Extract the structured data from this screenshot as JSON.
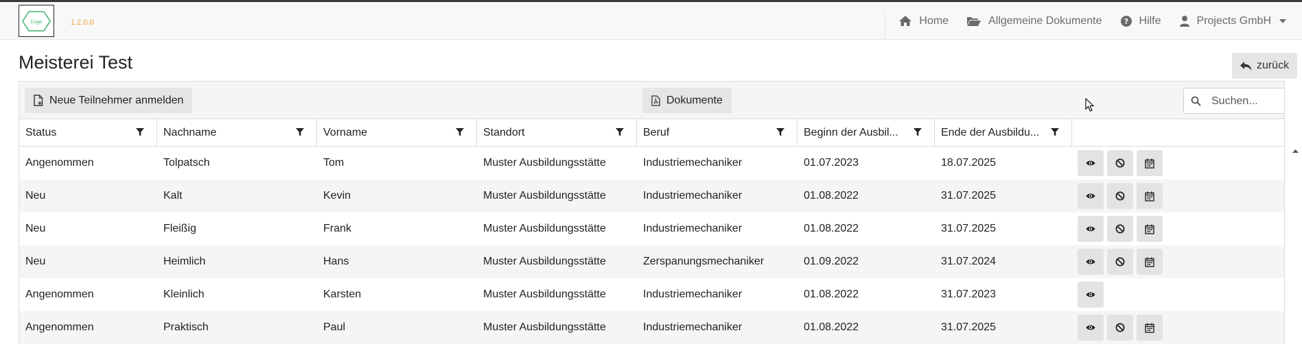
{
  "app": {
    "logo_text": "Logo",
    "version": "1.2.0.0"
  },
  "nav": {
    "items": [
      {
        "label": "Home",
        "icon": "home-icon"
      },
      {
        "label": "Allgemeine Dokumente",
        "icon": "folder-open-icon"
      },
      {
        "label": "Hilfe",
        "icon": "question-circle-icon"
      },
      {
        "label": "Projects GmbH",
        "icon": "user-icon"
      }
    ]
  },
  "page": {
    "title": "Meisterei Test",
    "back_label": "zurück"
  },
  "toolbar": {
    "new_label": "Neue Teilnehmer anmelden",
    "docs_label": "Dokumente",
    "search_placeholder": "Suchen..."
  },
  "table": {
    "columns": [
      "Status",
      "Nachname",
      "Vorname",
      "Standort",
      "Beruf",
      "Beginn der Ausbil...",
      "Ende der Ausbildu...",
      ""
    ],
    "rows": [
      {
        "status": "Angenommen",
        "nachname": "Tolpatsch",
        "vorname": "Tom",
        "standort": "Muster Ausbildungsstätte",
        "beruf": "Industriemechaniker",
        "beginn": "01.07.2023",
        "ende": "18.07.2025",
        "actions": [
          "view",
          "cancel",
          "calendar"
        ]
      },
      {
        "status": "Neu",
        "nachname": "Kalt",
        "vorname": "Kevin",
        "standort": "Muster Ausbildungsstätte",
        "beruf": "Industriemechaniker",
        "beginn": "01.08.2022",
        "ende": "31.07.2025",
        "actions": [
          "view",
          "cancel",
          "calendar"
        ]
      },
      {
        "status": "Neu",
        "nachname": "Fleißig",
        "vorname": "Frank",
        "standort": "Muster Ausbildungsstätte",
        "beruf": "Industriemechaniker",
        "beginn": "01.08.2022",
        "ende": "31.07.2025",
        "actions": [
          "view",
          "cancel",
          "calendar"
        ]
      },
      {
        "status": "Neu",
        "nachname": "Heimlich",
        "vorname": "Hans",
        "standort": "Muster Ausbildungsstätte",
        "beruf": "Zerspanungsmechaniker",
        "beginn": "01.09.2022",
        "ende": "31.07.2024",
        "actions": [
          "view",
          "cancel",
          "calendar"
        ]
      },
      {
        "status": "Angenommen",
        "nachname": "Kleinlich",
        "vorname": "Karsten",
        "standort": "Muster Ausbildungsstätte",
        "beruf": "Industriemechaniker",
        "beginn": "01.08.2022",
        "ende": "31.07.2023",
        "actions": [
          "view"
        ]
      },
      {
        "status": "Angenommen",
        "nachname": "Praktisch",
        "vorname": "Paul",
        "standort": "Muster Ausbildungsstätte",
        "beruf": "Industriemechaniker",
        "beginn": "01.08.2022",
        "ende": "31.07.2025",
        "actions": [
          "view",
          "cancel",
          "calendar"
        ]
      }
    ]
  },
  "colors": {
    "navbar_bg": "#f8f8f8",
    "button_bg": "#e6e6e6",
    "version_color": "#f0a030",
    "logo_green": "#3cb371"
  }
}
